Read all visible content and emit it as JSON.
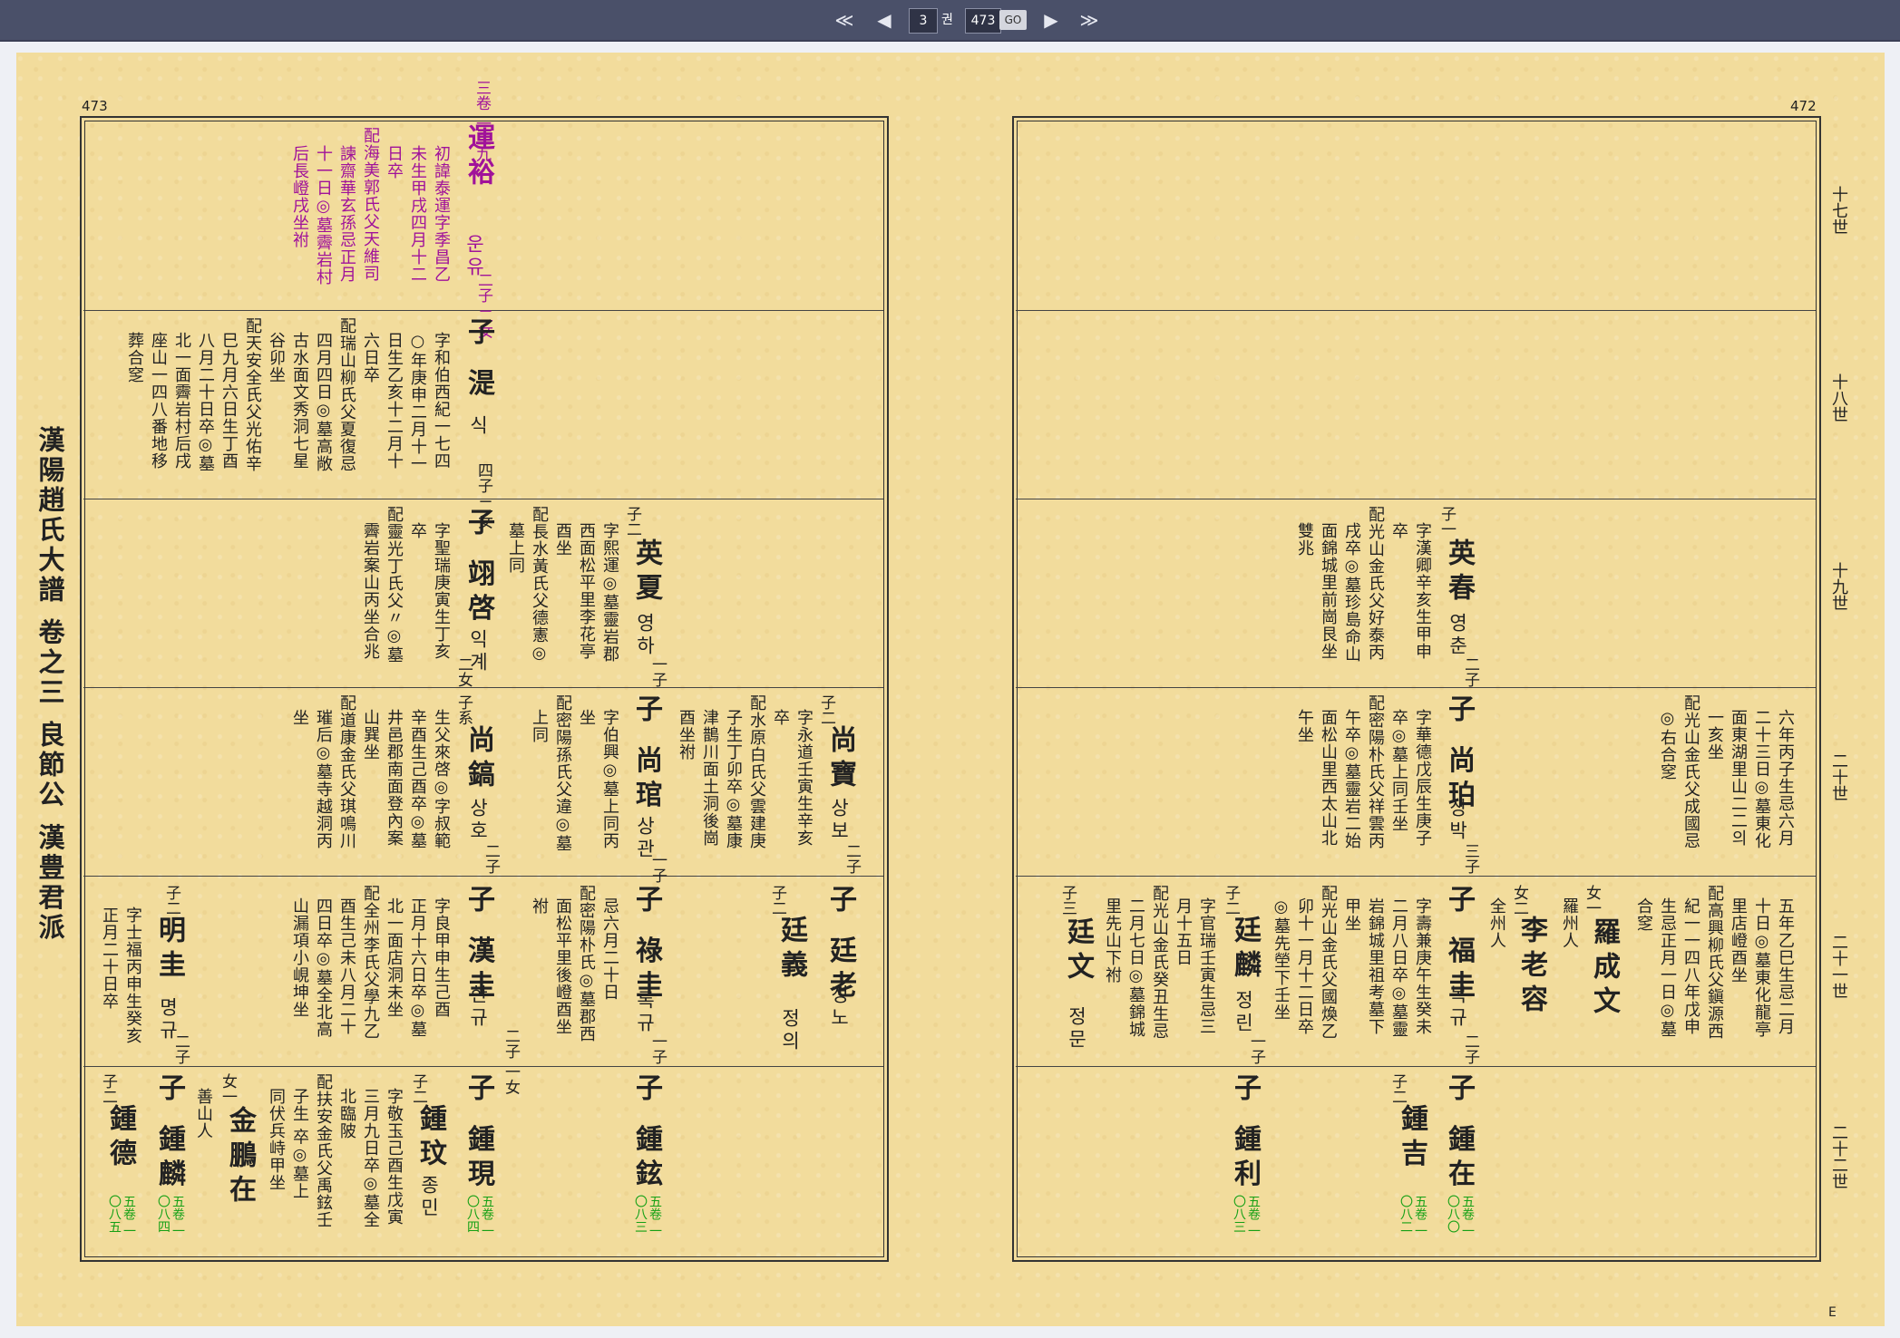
{
  "nav": {
    "first": "≪",
    "prev": "◀",
    "volume": "3",
    "volume_unit": "권",
    "page": "473",
    "go": "GO",
    "next": "▶",
    "last": "≫"
  },
  "left": {
    "page_number": "473",
    "spine": "漢陽趙氏大譜 卷之三 良節公 漢豊君派",
    "e1": {
      "vol": "三卷 一二九",
      "name": "運裕",
      "hangul": "운유",
      "kids": "二子 二女",
      "t1": "初諱泰運字季昌乙",
      "t2": "未生甲戌四月十二",
      "t3": "日卒",
      "t4": "配海美郭氏父天維司",
      "t5": "諫齋華玄孫忌正月",
      "t6": "十一日◎墓霽岩村",
      "t7": "后長嶝戌坐祔"
    },
    "e2": {
      "name": "子 湜",
      "hangul": "식",
      "kids": "四子 二女",
      "t1": "字和伯西紀一七四",
      "t2": "○年庚申二月十一",
      "t3": "日生乙亥十二月十",
      "t4": "六日卒",
      "t5": "配瑞山柳氏父夏復忌",
      "t6": "四月四日◎墓高敞",
      "t7": "古水面文秀洞七星",
      "t8": "谷卯坐",
      "t9": "配天安全氏父光佑辛",
      "t10": "巳九月六日生丁酉",
      "t11": "八月二十日卒◎墓",
      "t12": "北一面霽岩村后戌",
      "t13": "座山一四八番地移",
      "t14": "葬合窆"
    },
    "e3a": {
      "tag": "子二",
      "name": "英夏",
      "hangul": "영하",
      "kids": "一子",
      "t1": "字熙運◎墓靈岩郡",
      "t2": "西面松平里李花亭",
      "t3": "酉坐",
      "t4": "配長水黃氏父德憲◎",
      "t5": "墓上同"
    },
    "e3b": {
      "name": "子 翊啓",
      "hangul": "익계",
      "kids": "二女",
      "t1": "字聖瑞庚寅生丁亥",
      "t2": "卒",
      "t3": "配靈光丁氏父〃◎墓",
      "t4": "霽岩案山丙坐合兆"
    },
    "e4a": {
      "tag": "子二",
      "name": "尚寶",
      "hangul": "상보",
      "kids": "二子",
      "t1": "字永道壬寅生辛亥",
      "t2": "卒",
      "t3": "配水原白氏父雲建庚",
      "t4": "子生丁卯卒◎墓康",
      "t5": "津鵲川面土洞後崗",
      "t6": "酉坐祔"
    },
    "e4b": {
      "name": "子 尚琯",
      "hangul": "상관",
      "kids": "一子",
      "t1": "字伯興◎墓上同丙",
      "t2": "坐",
      "t3": "配密陽孫氏父違◎墓",
      "t4": "上同"
    },
    "e4c": {
      "tag": "子系",
      "name": "尚鎬",
      "hangul": "상호",
      "kids": "二子",
      "t1": "生父來啓◎字叔範",
      "t2": "辛酉生己酉卒◎墓",
      "t3": "井邑郡南面登內案",
      "t4": "山巽坐",
      "t5": "配道康金氏父琪鳴川",
      "t6": "璀后◎墓寺越洞丙",
      "t7": "坐"
    },
    "e5a": {
      "name": "子 廷老",
      "hangul": "정노"
    },
    "e5b": {
      "tag": "子二",
      "name": "廷義",
      "hangul": "정의"
    },
    "e5c": {
      "name": "子 祿圭",
      "hangul": "록규",
      "kids": "一子",
      "t1": "忌六月二十日",
      "t2": "配密陽朴氏◎墓郡西",
      "t3": "面松平里後嶝酉坐",
      "t4": "祔"
    },
    "e5d": {
      "name": "子 漢圭",
      "hangul": "한규",
      "kids": "二子 一女",
      "t1": "字良甲申生己酉",
      "t2": "正月十六日卒◎墓",
      "t3": "北一面店洞未坐",
      "t4": "配全州李氏父學九乙",
      "t5": "酉生己未八月二十",
      "t6": "四日卒◎墓全北高",
      "t7": "山漏項小峴坤坐"
    },
    "e5e": {
      "tag": "子二",
      "name": "明圭",
      "hangul": "명규",
      "kids": "二子",
      "t1": "字士福丙申生癸亥",
      "t2": "正月二十日卒"
    },
    "e6a": {
      "name": "子 鍾鉉",
      "vol": "五卷 一〇八三"
    },
    "e6b": {
      "name": "子 鍾現",
      "vol": "五卷 一〇八四"
    },
    "e6c": {
      "tag": "子二",
      "name": "鍾玟",
      "hangul": "종민",
      "t1": "字敬玉己酉生戊寅",
      "t2": "三月九日卒◎墓全",
      "t3": "北臨陂",
      "t4": "配扶安金氏父禹鉉壬",
      "t5": "子生 卒◎墓上",
      "t6": "同伏兵峙甲坐"
    },
    "e6d": {
      "tag": "女一",
      "name": "金鵬在",
      "t1": "善山人"
    },
    "e6e": {
      "name": "子 鍾麟",
      "vol": "五卷 一〇八四"
    },
    "e6f": {
      "tag": "子二",
      "name": "鍾德",
      "vol": "五卷 一〇八五"
    }
  },
  "right": {
    "page_number": "472",
    "generations": [
      "十七世",
      "十八世",
      "十九世",
      "二十世",
      "二十一世",
      "二十二世"
    ],
    "e3": {
      "tag": "子一",
      "name": "英春",
      "hangul": "영춘",
      "kids": "二子",
      "t1": "字漢卿辛亥生甲申",
      "t2": "卒",
      "t3": "配光山金氏父好泰丙",
      "t4": "戌卒◎墓珍島命山",
      "t5": "面錦城里前崗艮坐",
      "t6": "雙兆"
    },
    "e4a": {
      "t1": "六年丙子生忌六月",
      "t2": "二十三日◎墓東化",
      "t3": "面東湖里山二二의",
      "t4": "一亥坐",
      "t5": "配光山金氏父成國忌",
      "t6": "◎右合窆"
    },
    "e4b": {
      "name": "子 尚珀",
      "hangul": "상박",
      "kids": "三子",
      "t1": "字華德戊辰生庚子",
      "t2": "卒◎墓上同壬坐",
      "t3": "配密陽朴氏父祥雲丙",
      "t4": "午卒◎墓靈岩二始",
      "t5": "面松山里西太山北",
      "t6": "午坐"
    },
    "e5a": {
      "t1": "五年乙巳生忌二月",
      "t2": "十日◎墓東化龍亭",
      "t3": "里店嶝酉坐",
      "t4": "配高興柳氏父鎭源西",
      "t5": "紀一一四八年戊申",
      "t6": "生忌正月一日◎墓",
      "t7": "合窆"
    },
    "e5b": {
      "tag": "女一",
      "name": "羅成文",
      "t1": "羅州人"
    },
    "e5c": {
      "tag": "女二",
      "name": "李老容",
      "t1": "全州人"
    },
    "e5d": {
      "name": "子 福圭",
      "hangul": "복규",
      "kids": "二子",
      "t1": "字壽兼庚午生癸未",
      "t2": "二月八日卒◎墓靈",
      "t3": "岩錦城里祖考墓下",
      "t4": "甲坐",
      "t5": "配光山金氏父國煥乙",
      "t6": "卯十一月十二日卒",
      "t7": "◎墓先塋下壬坐"
    },
    "e5e": {
      "tag": "子二",
      "name": "廷麟",
      "hangul": "정린",
      "kids": "一子",
      "t1": "字官瑞壬寅生忌三",
      "t2": "月十五日",
      "t3": "配光山金氏癸丑生忌",
      "t4": "二月七日◎墓錦城",
      "t5": "里先山下祔"
    },
    "e5f": {
      "tag": "子三",
      "name": "廷文",
      "hangul": "정문"
    },
    "e6a": {
      "name": "子 鍾在",
      "vol": "五卷 一〇八〇"
    },
    "e6b": {
      "tag": "子二",
      "name": "鍾吉",
      "vol": "五卷 一〇八二"
    },
    "e6c": {
      "name": "子 鍾利",
      "vol": "五卷 一〇八三"
    },
    "corner": "E"
  }
}
